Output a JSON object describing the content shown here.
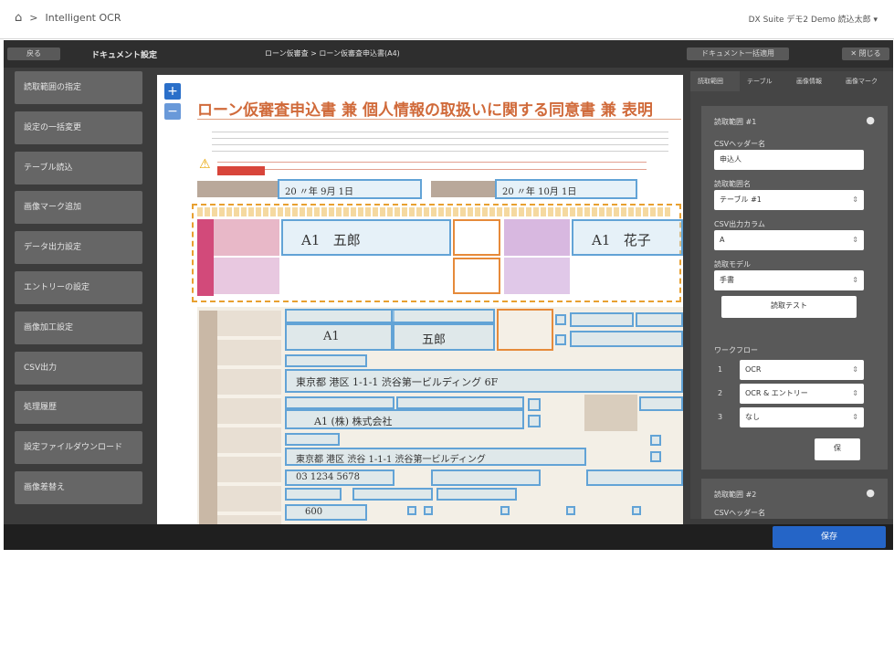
{
  "header": {
    "breadcrumb_sep": ">",
    "app_title": "Intelligent OCR",
    "user_label": "DX Suite デモ2 Demo 読込太郎 ▾"
  },
  "toolbar": {
    "back_label": "戻る",
    "section_title": "ドキュメント設定",
    "doc_path": "ローン仮審査 > ローン仮審査申込書(A4)",
    "doc_settings_button": "ドキュメント一括適用",
    "close_button": "✕ 閉じる"
  },
  "sidebar": {
    "items": [
      {
        "label": "読取範囲の指定"
      },
      {
        "label": "設定の一括変更"
      },
      {
        "label": "テーブル読込"
      },
      {
        "label": "画像マーク追加"
      },
      {
        "label": "データ出力設定"
      },
      {
        "label": "エントリーの設定"
      },
      {
        "label": "画像加工設定"
      },
      {
        "label": "CSV出力"
      },
      {
        "label": "処理履歴"
      },
      {
        "label": "設定ファイルダウンロード"
      },
      {
        "label": "画像差替え"
      }
    ]
  },
  "document": {
    "title": "ローン仮審査申込書 兼 個人情報の取扱いに関する同意書 兼 表明",
    "applicant_name_1": "A1",
    "applicant_name_2": "五郎",
    "applicant_name_3": "A1",
    "applicant_name_4": "花子",
    "date_1": "20 〃年 9月 1日",
    "date_2": "20 〃年 10月 1日",
    "name_row": "A1",
    "name_row2": "五郎",
    "address_1": "東京都 港区 1-1-1 渋谷第一ビルディング 6F",
    "company": "A1 (株) 株式会社",
    "address_2": "東京都 港区 渋谷 1-1-1 渋谷第一ビルディング",
    "phone": "03 1234 5678",
    "amount": "600"
  },
  "right_panel": {
    "tabs": [
      "読取範囲",
      "テーブル",
      "画像情報",
      "画像マーク"
    ],
    "card1": {
      "title": "読取範囲 #1",
      "csv_header_label": "CSVヘッダー名",
      "csv_header_value": "申込人",
      "region_name_label": "読取範囲名",
      "region_name_value": "テーブル #1",
      "csv_column_label": "CSV出力カラム",
      "csv_column_value": "A",
      "model_label": "読取モデル",
      "model_value": "手書",
      "test_button": "読取テスト",
      "workflow_label": "ワークフロー",
      "workflow": [
        {
          "num": "1",
          "value": "OCR"
        },
        {
          "num": "2",
          "value": "OCR & エントリー"
        },
        {
          "num": "3",
          "value": "なし"
        }
      ],
      "small_button": "保"
    },
    "card2": {
      "title": "読取範囲 #2",
      "csv_header_label": "CSVヘッダー名"
    }
  },
  "footer": {
    "save_label": "保存"
  }
}
